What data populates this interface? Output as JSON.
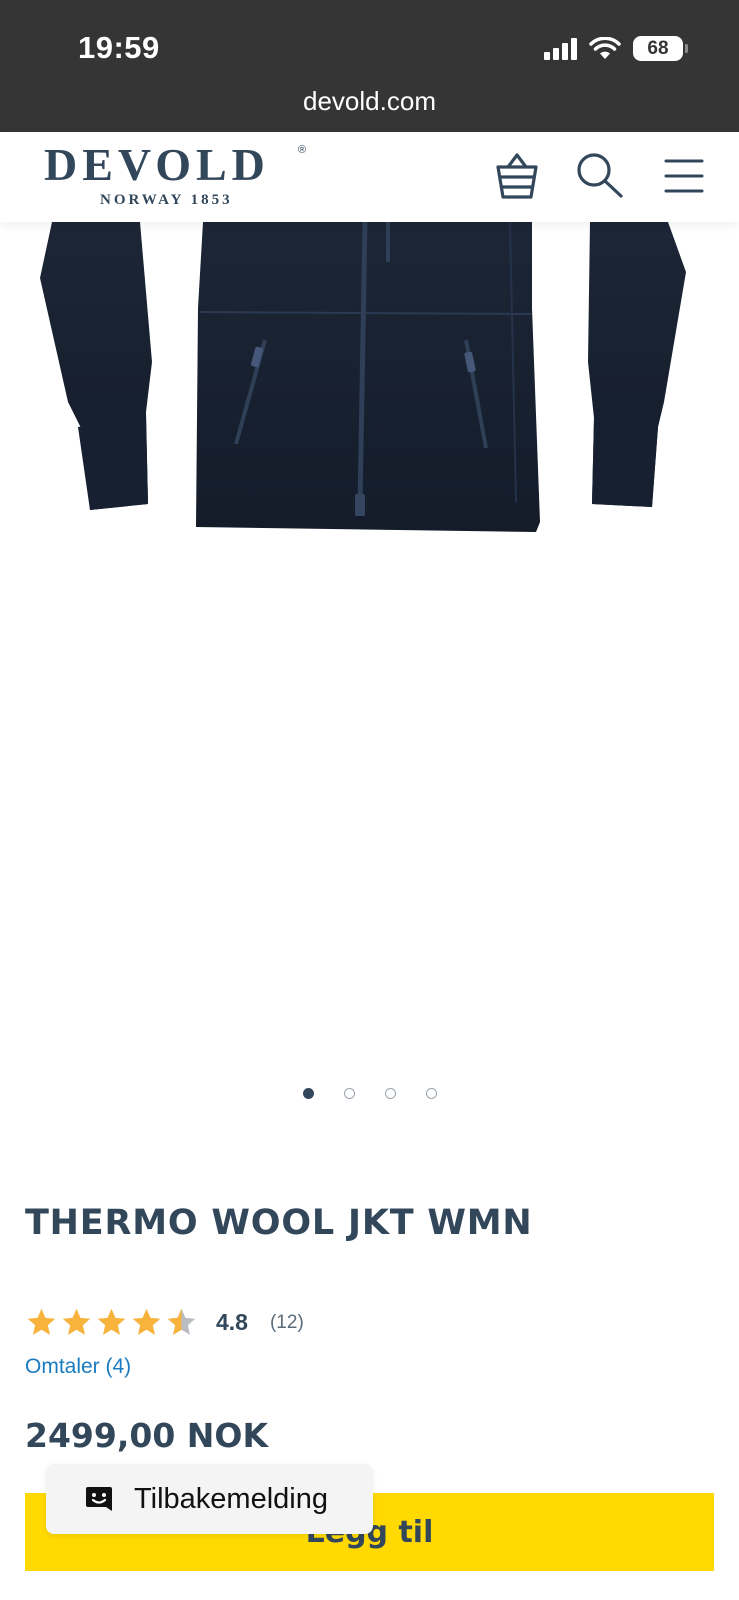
{
  "status_bar": {
    "time": "19:59",
    "battery_level": "68",
    "url": "devold.com"
  },
  "header": {
    "logo_text": "DEVOLD",
    "logo_registered": "®",
    "logo_subtitle": "NORWAY 1853",
    "icons": [
      "basket-icon",
      "search-icon",
      "menu-icon"
    ]
  },
  "carousel": {
    "total_slides": 4,
    "active_index": 0
  },
  "product": {
    "title": "THERMO WOOL JKT WMN",
    "rating_value": "4.8",
    "rating_stars": 4.5,
    "rating_count": "(12)",
    "reviews_link": "Omtaler (4)",
    "price": "2499,00 NOK",
    "add_to_cart_label": "Legg til"
  },
  "feedback": {
    "label": "Tilbakemelding"
  },
  "colors": {
    "brand": "#33475b",
    "cta": "#ffd900",
    "star": "#f7b33b",
    "link": "#1a7bc0",
    "statusbar": "#353535"
  }
}
